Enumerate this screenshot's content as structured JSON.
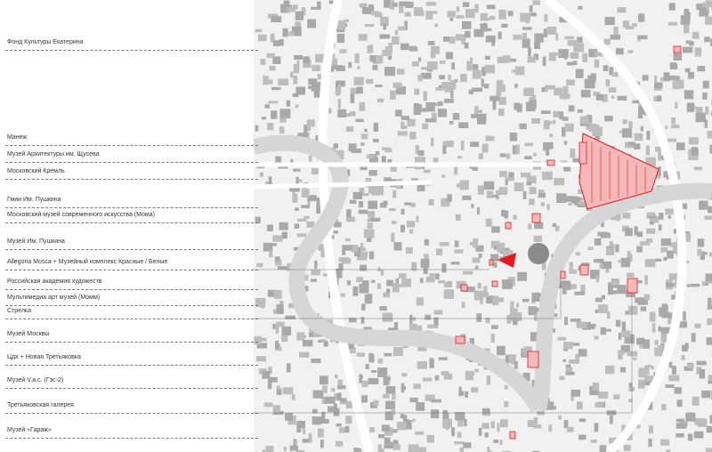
{
  "legend": {
    "items": [
      {
        "label": "Фонд Культуры Екатерина"
      },
      {
        "label": "Манеж"
      },
      {
        "label": "Музей Архитектуры им. Щусева"
      },
      {
        "label": "Московский Кремль"
      },
      {
        "label": "Гмии Им. Пушкина"
      },
      {
        "label": "Московский музей современного искусства (Мома)"
      },
      {
        "label": "Музей Им. Пушкина"
      },
      {
        "label": "Allegoria Mosca + Музейный комплекс Красные / Белые"
      },
      {
        "label": "Российская академия художеств"
      },
      {
        "label": "Мультимедиа арт музей (Момм)"
      },
      {
        "label": "Стрелка"
      },
      {
        "label": "Музей Москвы"
      },
      {
        "label": "Цдх + Новая Третьяковка"
      },
      {
        "label": "Музей V.a.c. (Гэс-2)"
      },
      {
        "label": "Третьяковская галерея"
      },
      {
        "label": "Музей «Гараж»"
      }
    ]
  },
  "colors": {
    "highlight": "#e8191f",
    "marker_fill": "#f4b8b8",
    "river": "#d9d9d9",
    "building": "#a9a9a9"
  }
}
